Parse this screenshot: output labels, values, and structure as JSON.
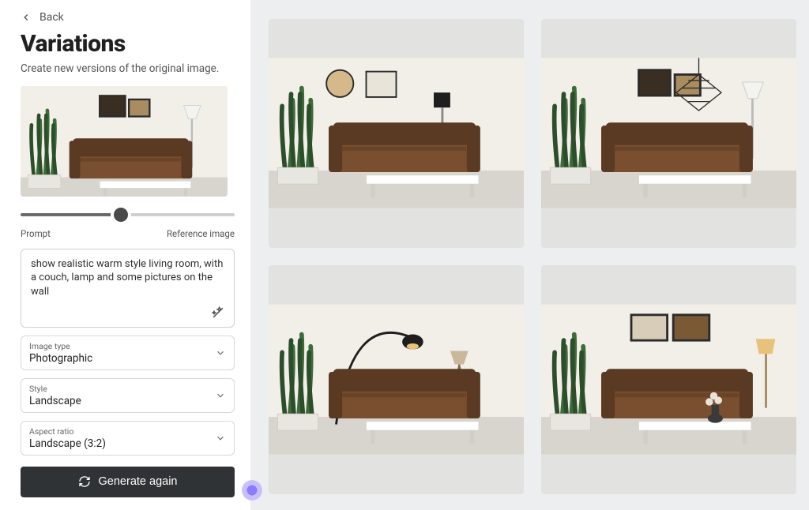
{
  "nav": {
    "back_label": "Back"
  },
  "header": {
    "title": "Variations",
    "subtitle": "Create new versions of the original image."
  },
  "slider": {
    "left_label": "Prompt",
    "right_label": "Reference image",
    "value": 47
  },
  "prompt": {
    "text": "show realistic warm style living room, with a couch, lamp and some pictures on the wall"
  },
  "fields": {
    "image_type": {
      "label": "Image type",
      "value": "Photographic"
    },
    "style": {
      "label": "Style",
      "value": "Landscape"
    },
    "aspect": {
      "label": "Aspect ratio",
      "value": "Landscape (3:2)"
    }
  },
  "action": {
    "generate_label": "Generate again"
  },
  "results": {
    "count": 4,
    "theme": "warm realistic living room with brown leather couch, snake plant, white coffee table, framed art, lamp",
    "tiles": [
      {
        "lamp": "black_cylinder",
        "art": "circle_and_square",
        "pendant": false
      },
      {
        "lamp": "white_cone",
        "art": "two_frames",
        "pendant": "wire_diamond"
      },
      {
        "lamp": "black_arc",
        "art": "none",
        "pendant": false,
        "tripod_lamp": true
      },
      {
        "lamp": "warm_shade",
        "art": "two_photos",
        "pendant": false,
        "vase": true
      }
    ]
  },
  "colors": {
    "couch": "#7a4f2f",
    "couch_dark": "#5a3a22",
    "wall": "#f2efe9",
    "floor": "#d8d5cf",
    "plant": "#3e6b3a",
    "plant_dark": "#2d4e2a",
    "table": "#ffffff",
    "frame": "#2b2b2b",
    "lamp_black": "#1e1e1e",
    "lamp_white": "#f3f3f0",
    "warm_glow": "#e8c27a"
  }
}
